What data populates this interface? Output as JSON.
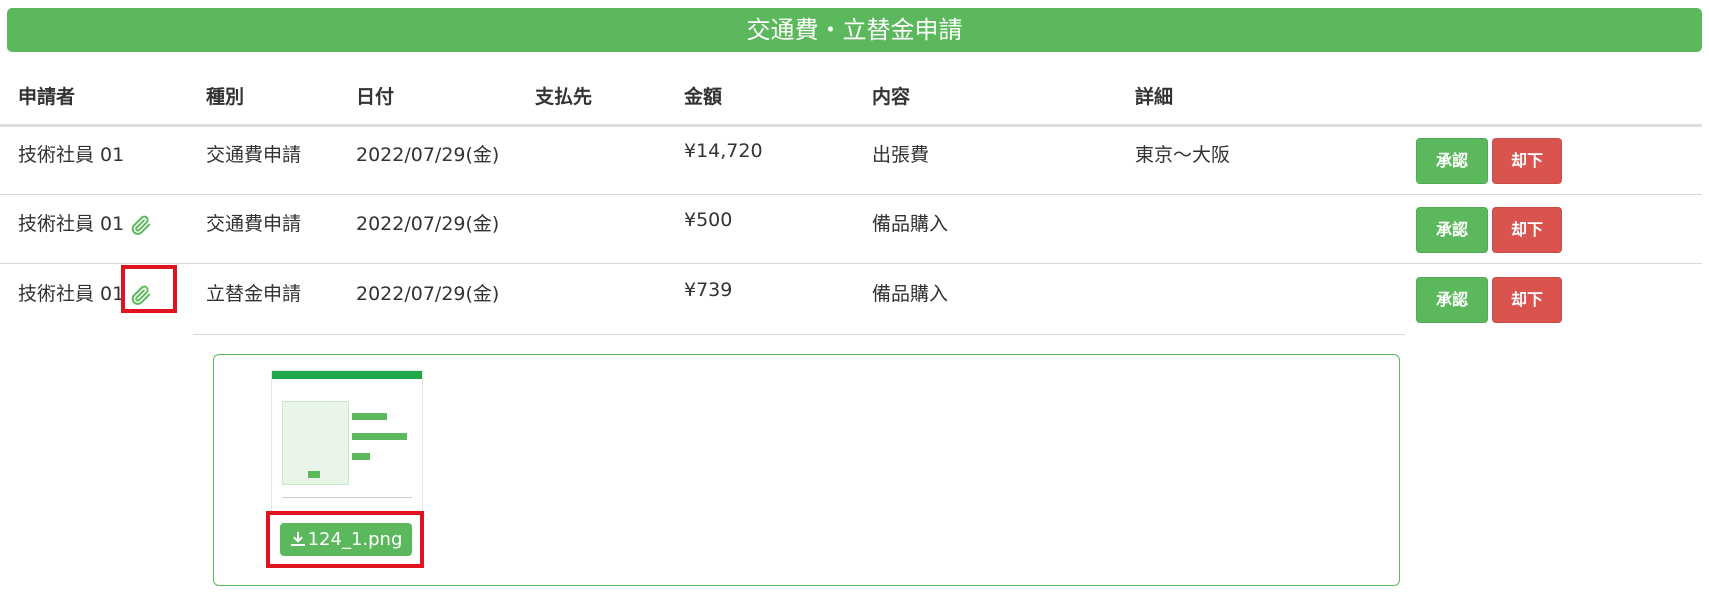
{
  "title": "交通費・立替金申請",
  "columns": [
    "申請者",
    "種別",
    "日付",
    "支払先",
    "金額",
    "内容",
    "詳細"
  ],
  "rows": [
    {
      "applicant": "技術社員 01",
      "type": "交通費申請",
      "date": "2022/07/29(金)",
      "payee": "",
      "amount": "¥14,720",
      "content": "出張費",
      "detail": "東京～大阪",
      "has_attachment": false
    },
    {
      "applicant": "技術社員 01",
      "type": "交通費申請",
      "date": "2022/07/29(金)",
      "payee": "",
      "amount": "¥500",
      "content": "備品購入",
      "detail": "",
      "has_attachment": true
    },
    {
      "applicant": "技術社員 01",
      "type": "立替金申請",
      "date": "2022/07/29(金)",
      "payee": "",
      "amount": "¥739",
      "content": "備品購入",
      "detail": "",
      "has_attachment": true
    }
  ],
  "buttons": {
    "approve": "承認",
    "reject": "却下"
  },
  "attachment": {
    "filename": "124_1.png",
    "download_icon": "download-icon"
  },
  "icons": {
    "attachment": "paperclip-icon"
  },
  "colors": {
    "primary": "#5cb85c",
    "danger": "#d9534f",
    "highlight": "#e0141e"
  }
}
